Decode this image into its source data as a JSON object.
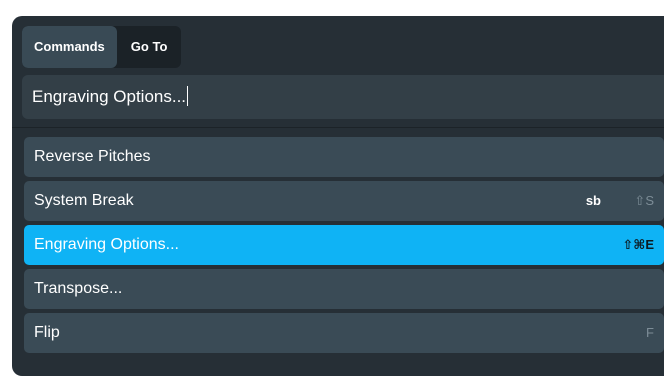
{
  "tabs": {
    "commands": "Commands",
    "goto": "Go To"
  },
  "search": {
    "value": "Engraving Options..."
  },
  "results": [
    {
      "label": "Reverse Pitches",
      "alias": "",
      "shortcut": ""
    },
    {
      "label": "System Break",
      "alias": "sb",
      "shortcut": "⇧S"
    },
    {
      "label": "Engraving Options...",
      "alias": "",
      "shortcut": "⇧⌘E",
      "selected": true
    },
    {
      "label": "Transpose...",
      "alias": "",
      "shortcut": ""
    },
    {
      "label": "Flip",
      "alias": "",
      "shortcut": "F"
    }
  ],
  "colors": {
    "panel": "#262f36",
    "row": "#3a4b56",
    "selected_row": "#0fb3f5"
  }
}
